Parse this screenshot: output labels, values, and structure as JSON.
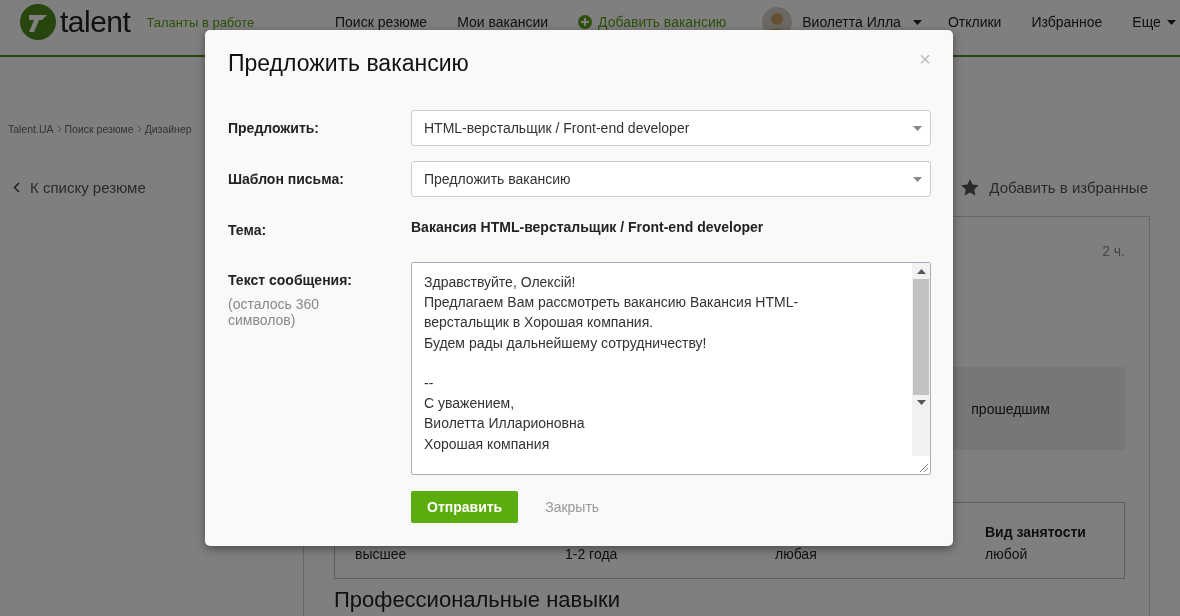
{
  "header": {
    "logo": "talent",
    "tagline": "Таланты в работе",
    "nav": [
      {
        "label": "Поиск резюме",
        "kind": "link"
      },
      {
        "label": "Мои вакансии",
        "kind": "link"
      },
      {
        "label": "Добавить вакансию",
        "kind": "add"
      }
    ],
    "user": "Виолетта Илла",
    "links": [
      "Отклики",
      "Избранное"
    ],
    "more": "Еще"
  },
  "breadcrumbs": [
    "Talent.UA",
    "Поиск резюме",
    "Дизайнер"
  ],
  "back_link": "К списку резюме",
  "favorite": "Добавить в избранные",
  "card": {
    "time": "2 ч.",
    "notice": "прошедшим",
    "table": [
      {
        "value": "высшее"
      },
      {
        "value": "1-2 года"
      },
      {
        "value": "любая"
      },
      {
        "label": "Вид занятости",
        "value": "любой"
      }
    ],
    "section_title": "Профессиональные навыки"
  },
  "modal": {
    "title": "Предложить вакансию",
    "close": "×",
    "fields": [
      {
        "kind": "select",
        "label": "Предложить:",
        "value": "HTML-верстальщик / Front-end developer"
      },
      {
        "kind": "select",
        "label": "Шаблон письма:",
        "value": "Предложить вакансию"
      },
      {
        "kind": "text",
        "label": "Тема:",
        "value": "Вакансия HTML-верстальщик / Front-end developer"
      }
    ],
    "message": {
      "label": "Текст сообщения:",
      "hint": "(осталось 360 символов)",
      "paragraphs": [
        [
          "Здравствуйте, Олексій!",
          "Предлагаем Вам рассмотреть вакансию Вакансия HTML-верстальщик в Хорошая компания.",
          "Будем рады дальнейшему сотрудничеству!"
        ],
        [
          "--",
          "С уважением,",
          "Виолетта Илларионовна",
          "Хорошая компания"
        ]
      ]
    },
    "send": "Отправить",
    "cancel": "Закрыть"
  }
}
